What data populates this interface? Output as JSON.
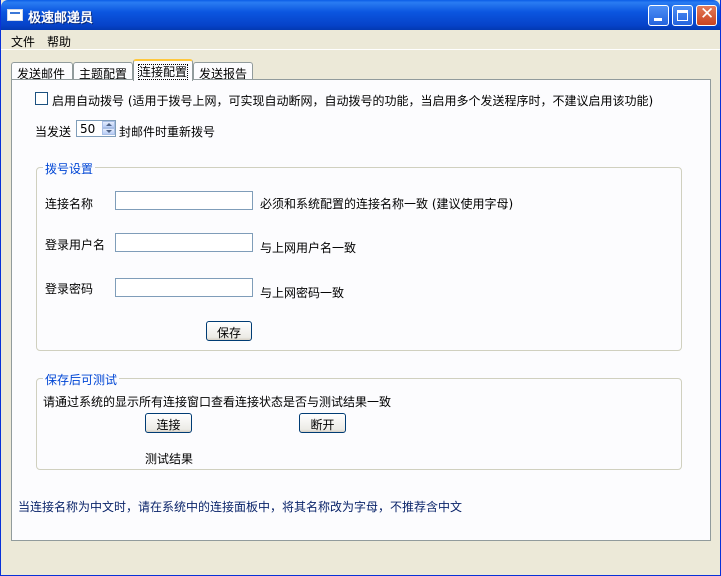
{
  "window": {
    "title": "极速邮递员"
  },
  "menu": {
    "file": "文件",
    "help": "帮助"
  },
  "tabs": [
    {
      "label": "发送邮件"
    },
    {
      "label": "主题配置"
    },
    {
      "label": "连接配置"
    },
    {
      "label": "发送报告"
    }
  ],
  "active_tab": 2,
  "auto_dial": {
    "checked": false,
    "label": "启用自动拨号 (适用于拨号上网，可实现自动断网，自动拨号的功能，当启用多个发送程序时，不建议启用该功能)"
  },
  "redial": {
    "prefix": "当发送",
    "value": "50",
    "suffix": "封邮件时重新拨号"
  },
  "dial_settings": {
    "title": "拨号设置",
    "connection_name_label": "连接名称",
    "connection_name_value": "",
    "connection_name_hint": "必须和系统配置的连接名称一致 (建议使用字母)",
    "username_label": "登录用户名",
    "username_value": "",
    "username_hint": "与上网用户名一致",
    "password_label": "登录密码",
    "password_value": "",
    "password_hint": "与上网密码一致",
    "save_button": "保存"
  },
  "test_section": {
    "title": "保存后可测试",
    "description": "请通过系统的显示所有连接窗口查看连接状态是否与测试结果一致",
    "connect_button": "连接",
    "disconnect_button": "断开",
    "result_label": "测试结果"
  },
  "footer_note": "当连接名称为中文时，请在系统中的连接面板中，将其名称改为字母，不推荐含中文",
  "colors": {
    "titlebar": "#0b56e0",
    "group_title": "#0046d5",
    "note_text": "#0a246a",
    "window_bg": "#ece9d8"
  }
}
